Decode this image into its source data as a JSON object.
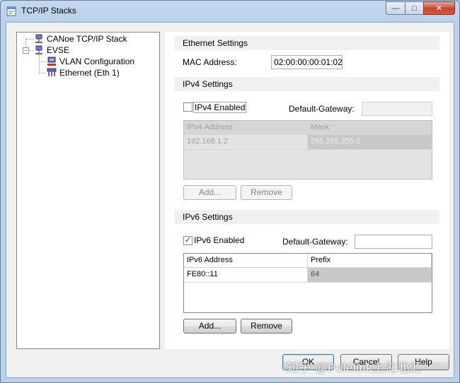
{
  "window": {
    "title": "TCP/IP Stacks",
    "controls": {
      "minimize": "—",
      "maximize": "□",
      "close": "✕"
    }
  },
  "tree": {
    "nodes": [
      {
        "label": "CANoe TCP/IP Stack",
        "icon": "network-stack-icon"
      },
      {
        "label": "EVSE",
        "icon": "network-node-icon",
        "expander": "−"
      },
      {
        "label": "VLAN Configuration",
        "icon": "vlan-icon"
      },
      {
        "label": "Ethernet (Eth 1)",
        "icon": "ethernet-icon"
      }
    ]
  },
  "ethernet": {
    "header": "Ethernet Settings",
    "mac_label": "MAC Address:",
    "mac_value": "02:00:00:00:01:02"
  },
  "ipv4": {
    "header": "IPv4 Settings",
    "enabled_label": "IPv4 Enabled",
    "enabled": false,
    "gateway_label": "Default-Gateway:",
    "gateway_value": "",
    "columns": [
      "IPv4 Address",
      "Mask"
    ],
    "rows": [
      [
        "192.168.1.2",
        "255.255.255.0"
      ]
    ],
    "add_label": "Add...",
    "remove_label": "Remove"
  },
  "ipv6": {
    "header": "IPv6 Settings",
    "enabled_label": "IPv6 Enabled",
    "enabled": true,
    "check_mark": "✓",
    "gateway_label": "Default-Gateway:",
    "gateway_value": "",
    "columns": [
      "IPv6 Address",
      "Prefix"
    ],
    "rows": [
      [
        "FE80::11",
        "64"
      ]
    ],
    "add_label": "Add...",
    "remove_label": "Remove"
  },
  "footer": {
    "ok_label": "OK",
    "cancel_label": "Cancel",
    "help_label": "Help"
  },
  "watermark": "知乎 @Polelink上海北汇"
}
